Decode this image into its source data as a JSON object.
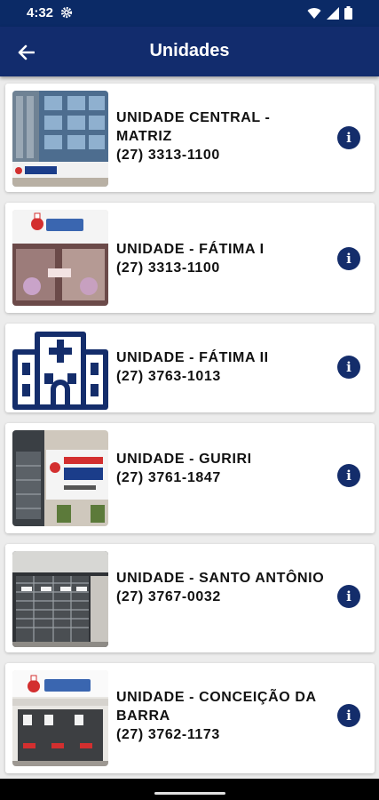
{
  "status": {
    "time": "4:32"
  },
  "app_bar": {
    "title": "Unidades"
  },
  "units": [
    {
      "name": "UNIDADE CENTRAL - MATRIZ",
      "phone": "(27) 3313-1100",
      "image": "building-photo"
    },
    {
      "name": "UNIDADE - FÁTIMA I",
      "phone": "(27) 3313-1100",
      "image": "storefront-photo"
    },
    {
      "name": "UNIDADE - FÁTIMA II",
      "phone": "(27) 3763-1013",
      "image": "hospital-building-icon"
    },
    {
      "name": "UNIDADE - GURIRI",
      "phone": "(27) 3761-1847",
      "image": "storefront-photo"
    },
    {
      "name": "UNIDADE - SANTO ANTÔNIO",
      "phone": "(27) 3767-0032",
      "image": "storefront-photo"
    },
    {
      "name": "UNIDADE - CONCEIÇÃO DA BARRA",
      "phone": "(27) 3762-1173",
      "image": "storefront-photo"
    }
  ],
  "colors": {
    "primary": "#122c6d",
    "status_bar": "#0b2a66",
    "background": "#ececec",
    "card": "#ffffff"
  }
}
